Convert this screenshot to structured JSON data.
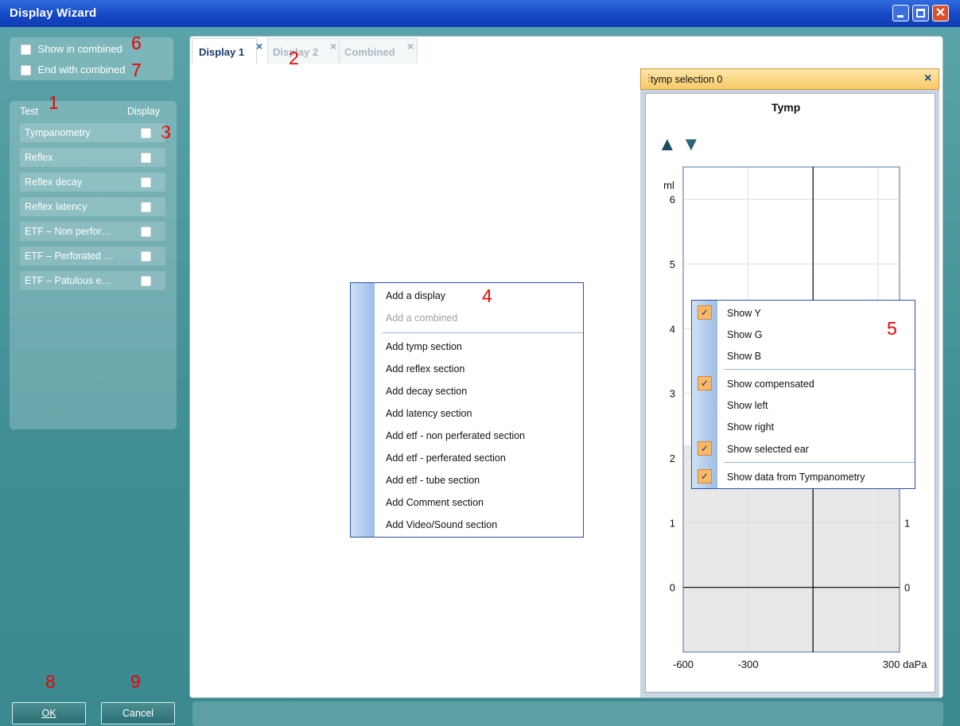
{
  "window": {
    "title": "Display Wizard",
    "close_glyph": "✕"
  },
  "options": {
    "show_in_combined": "Show in combined",
    "end_with_combined": "End with combined"
  },
  "test_panel": {
    "header_test": "Test",
    "header_display": "Display",
    "items": [
      "Tympanometry",
      "Reflex",
      "Reflex decay",
      "Reflex latency",
      "ETF – Non perfor…",
      "ETF – Perforated …",
      "ETF – Patulous e…"
    ]
  },
  "tabs": [
    {
      "label": "Display 1",
      "close": "×"
    },
    {
      "label": "Display 2",
      "close": "×"
    },
    {
      "label": "Combined",
      "close": "×"
    }
  ],
  "context_menu": {
    "items": [
      "Add a display",
      "Add a combined",
      "Add tymp section",
      "Add reflex section",
      "Add decay section",
      "Add latency section",
      "Add etf - non perferated section",
      "Add etf - perferated section",
      "Add etf - tube section",
      "Add Comment section",
      "Add Video/Sound section"
    ]
  },
  "tymp_panel": {
    "header": "tymp selection 0",
    "close": "×",
    "chart_title": "Tymp",
    "arrow_up": "▲",
    "arrow_down": "▼"
  },
  "chart_data": {
    "type": "line",
    "title": "Tymp",
    "ylabel": "ml",
    "xlabel": "daPa",
    "x_ticks": [
      "-600",
      "-300",
      "300 daPa"
    ],
    "y_ticks": [
      "0",
      "1",
      "2",
      "3",
      "4",
      "5",
      "6"
    ],
    "y2_ticks": [
      "0",
      "1"
    ],
    "xlim": [
      -600,
      400
    ],
    "ylim": [
      -1,
      6.5
    ],
    "grid": true,
    "series": []
  },
  "tymp_menu": {
    "items": [
      {
        "label": "Show Y",
        "checked": true
      },
      {
        "label": "Show G",
        "checked": false
      },
      {
        "label": "Show B",
        "checked": false
      },
      {
        "label": "Show compensated",
        "checked": true
      },
      {
        "label": "Show left",
        "checked": false
      },
      {
        "label": "Show right",
        "checked": false
      },
      {
        "label": "Show selected ear",
        "checked": true
      },
      {
        "label": "Show data from Tympanometry",
        "checked": true
      }
    ],
    "check_glyph": "✓"
  },
  "buttons": {
    "ok": "OK",
    "cancel": "Cancel"
  },
  "callouts": {
    "n1": "1",
    "n2": "2",
    "n3": "3",
    "n4": "4",
    "n5": "5",
    "n6": "6",
    "n7": "7",
    "n8": "8",
    "n9": "9"
  },
  "colors": {
    "title_bar": "#1648c6",
    "client_bg": "#3f8f95",
    "menu_border": "#2d4fa0",
    "check_bg": "#f6b96b",
    "callout": "#e00000"
  }
}
